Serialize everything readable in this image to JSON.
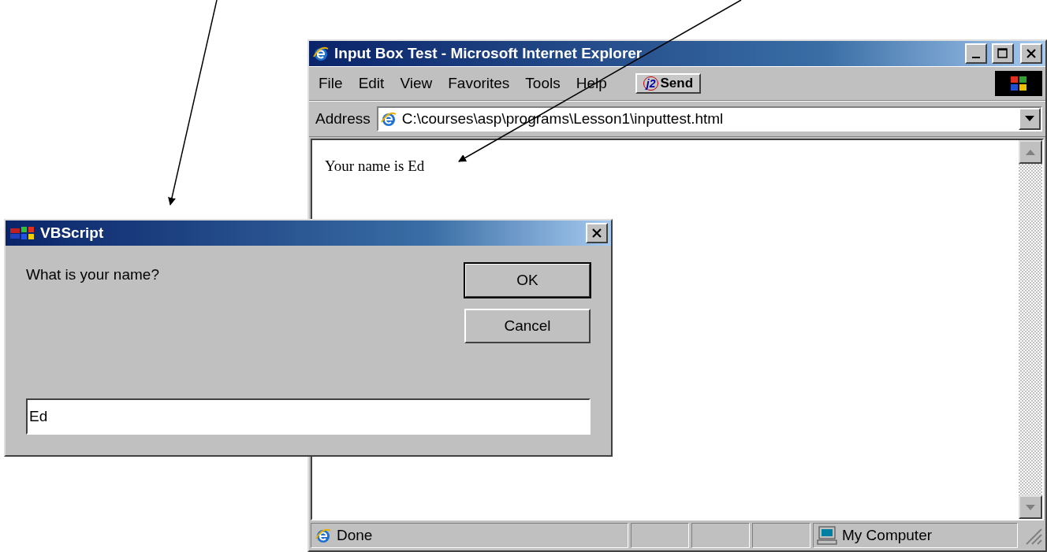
{
  "browser": {
    "title": "Input Box Test - Microsoft Internet Explorer",
    "menu": [
      "File",
      "Edit",
      "View",
      "Favorites",
      "Tools",
      "Help"
    ],
    "send_badge": "j2",
    "send_label": "Send",
    "address_label": "Address",
    "address": "C:\\courses\\asp\\programs\\Lesson1\\inputtest.html",
    "page_text": "Your name is Ed",
    "status": {
      "text": "Done",
      "zone": "My Computer"
    }
  },
  "dialog": {
    "title": "VBScript",
    "prompt": "What is your name?",
    "buttons": [
      {
        "label": "OK",
        "default": true
      },
      {
        "label": "Cancel",
        "default": false
      }
    ],
    "input": {
      "value": "Ed"
    }
  }
}
